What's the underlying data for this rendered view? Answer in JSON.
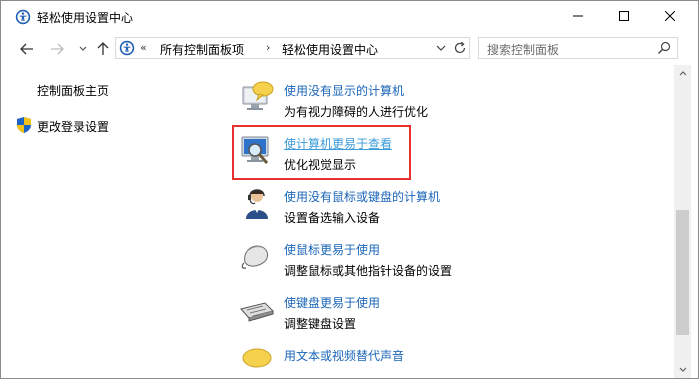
{
  "window": {
    "title": "轻松使用设置中心",
    "minimize_glyph": "minimize-icon",
    "maximize_glyph": "maximize-icon",
    "close_glyph": "close-icon"
  },
  "nav": {
    "back_icon": "arrow-left-icon",
    "forward_icon": "arrow-right-icon",
    "recent_icon": "chevron-down-icon",
    "up_icon": "arrow-up-icon"
  },
  "address": {
    "overflow": "«",
    "crumb1": "所有控制面板项",
    "separator": "›",
    "crumb2": "轻松使用设置中心"
  },
  "search": {
    "placeholder": "搜索控制面板"
  },
  "left": {
    "home": "控制面板主页",
    "change_login": "更改登录设置"
  },
  "items": [
    {
      "title": "使用没有显示的计算机",
      "desc": "为有视力障碍的人进行优化",
      "icon": "monitor-speech-icon"
    },
    {
      "title": "使计算机更易于查看",
      "desc": "优化视觉显示",
      "icon": "monitor-magnifier-icon"
    },
    {
      "title": "使用没有鼠标或键盘的计算机",
      "desc": "设置备选输入设备",
      "icon": "person-headset-icon"
    },
    {
      "title": "使鼠标更易于使用",
      "desc": "调整鼠标或其他指针设备的设置",
      "icon": "mouse-icon"
    },
    {
      "title": "使键盘更易于使用",
      "desc": "调整键盘设置",
      "icon": "keyboard-icon"
    },
    {
      "title": "用文本或视频替代声音",
      "desc": "",
      "icon": "speech-bubble-icon"
    }
  ],
  "colors": {
    "link": "#1a65b8",
    "highlight_box": "#e8302e"
  }
}
